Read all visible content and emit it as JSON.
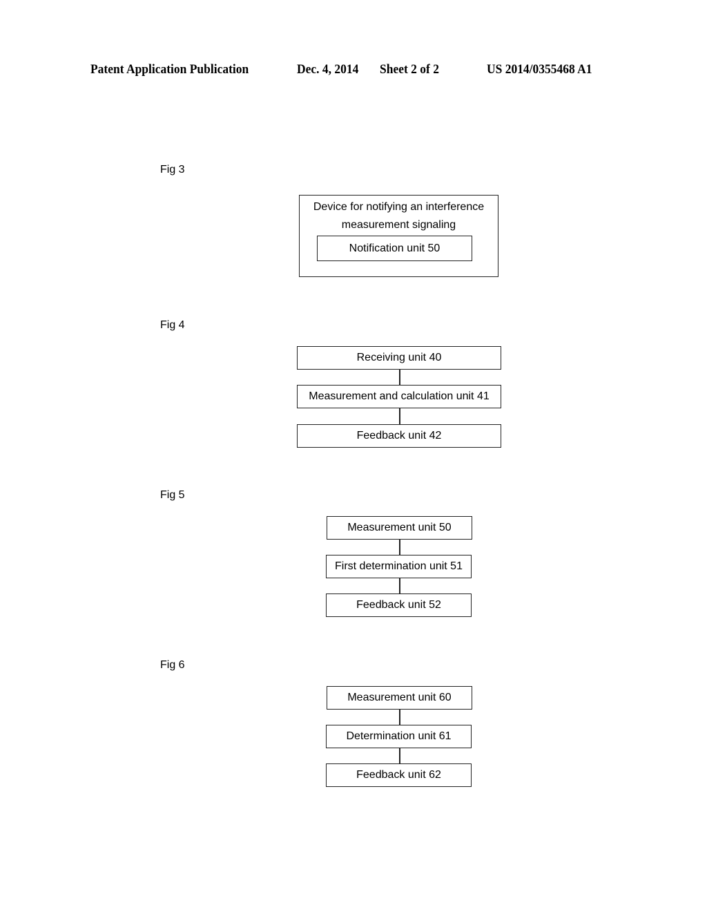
{
  "header": {
    "publication": "Patent Application Publication",
    "date": "Dec. 4, 2014",
    "sheet": "Sheet 2 of 2",
    "number": "US 2014/0355468 A1"
  },
  "fig3": {
    "label": "Fig 3",
    "outer_title_line1": "Device for notifying an interference",
    "outer_title_line2": "measurement signaling",
    "inner": "Notification unit 50"
  },
  "fig4": {
    "label": "Fig 4",
    "boxes": [
      "Receiving unit 40",
      "Measurement and calculation unit 41",
      "Feedback unit 42"
    ]
  },
  "fig5": {
    "label": "Fig 5",
    "boxes": [
      "Measurement unit 50",
      "First determination unit 51",
      "Feedback unit 52"
    ]
  },
  "fig6": {
    "label": "Fig 6",
    "boxes": [
      "Measurement unit 60",
      "Determination unit 61",
      "Feedback unit 62"
    ]
  }
}
